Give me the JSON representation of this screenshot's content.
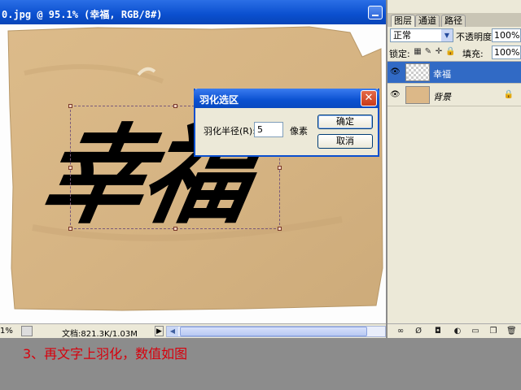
{
  "document": {
    "title": "0.jpg @ 95.1% (幸福, RGB/8#)",
    "zoom": "1%",
    "doc_size": "文档:821.3K/1.03M",
    "artwork_text": "幸福"
  },
  "dialog": {
    "title": "羽化选区",
    "radius_label": "羽化半径(R):",
    "radius_value": "5",
    "unit": "像素",
    "ok_label": "确定",
    "cancel_label": "取消",
    "close_glyph": "✕"
  },
  "layers_panel": {
    "tabs": [
      "图层",
      "通道",
      "路径"
    ],
    "blend_mode": "正常",
    "opacity_label": "不透明度:",
    "opacity_value": "100%",
    "lock_label": "锁定:",
    "fill_label": "填充:",
    "fill_value": "100%",
    "layers": [
      {
        "name": "幸福",
        "selected": true
      },
      {
        "name": "背景",
        "selected": false,
        "locked": true
      }
    ],
    "bottom_icons": [
      "link-icon",
      "style-icon",
      "mask-icon",
      "adjustment-icon",
      "group-icon",
      "new-layer-icon",
      "trash-icon"
    ]
  },
  "caption": "3、再文字上羽化，数值如图",
  "colors": {
    "title_bar": "#0a4fcf",
    "paper": "#d9b787",
    "ink": "#000000",
    "caption": "#d8000c",
    "selected_layer": "#316ac5"
  }
}
